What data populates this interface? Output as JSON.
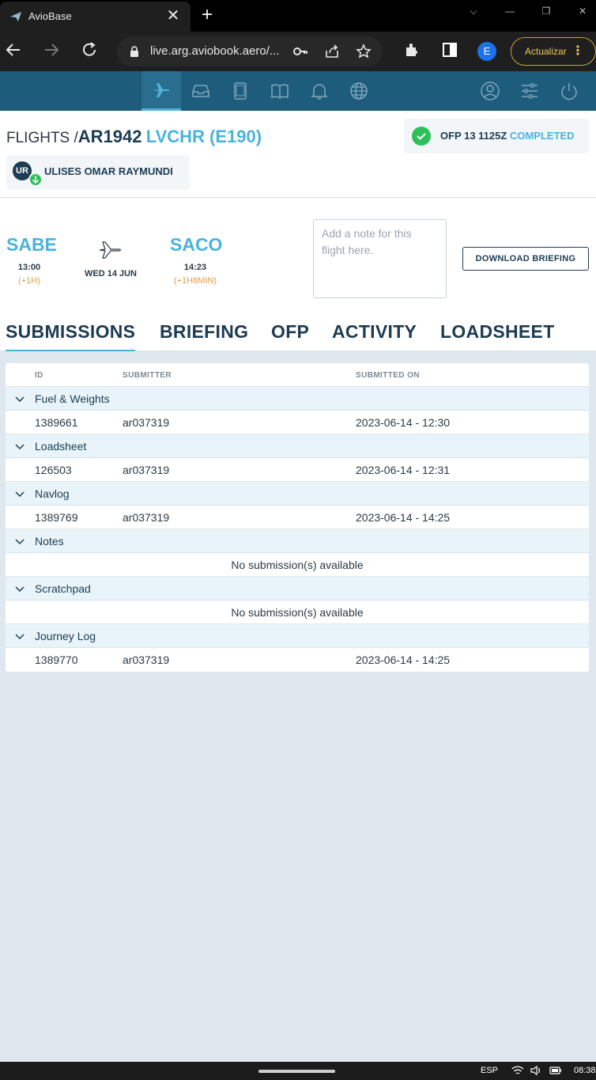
{
  "browser": {
    "tab_title": "AvioBase",
    "url": "live.arg.aviobook.aero/...",
    "profile_initial": "E",
    "update_label": "Actualizar"
  },
  "header": {
    "crumb_prefix": "FLIGHTS /",
    "flight_number": "AR1942",
    "aircraft": "LVCHR (E190)",
    "ofp_label": "OFP 13 1125Z",
    "ofp_status": "COMPLETED",
    "crew_initials": "UR",
    "crew_name": "ULISES OMAR RAYMUNDI"
  },
  "flight": {
    "origin": "SABE",
    "origin_time": "13:00",
    "origin_delay": "(+1H)",
    "date": "WED 14 JUN",
    "destination": "SACO",
    "destination_time": "14:23",
    "destination_delay": "(+1H8MIN)",
    "note_placeholder": "Add a note for this flight here.",
    "download_label": "DOWNLOAD BRIEFING"
  },
  "tabs": [
    "SUBMISSIONS",
    "BRIEFING",
    "OFP",
    "ACTIVITY",
    "LOADSHEET"
  ],
  "table": {
    "columns": [
      "ID",
      "SUBMITTER",
      "SUBMITTED ON"
    ],
    "empty_text": "No submission(s) available",
    "groups": [
      {
        "name": "Fuel & Weights",
        "rows": [
          [
            "1389661",
            "ar037319",
            "2023-06-14 - 12:30"
          ]
        ]
      },
      {
        "name": "Loadsheet",
        "rows": [
          [
            "126503",
            "ar037319",
            "2023-06-14 - 12:31"
          ]
        ]
      },
      {
        "name": "Navlog",
        "rows": [
          [
            "1389769",
            "ar037319",
            "2023-06-14 - 14:25"
          ]
        ]
      },
      {
        "name": "Notes",
        "rows": []
      },
      {
        "name": "Scratchpad",
        "rows": []
      },
      {
        "name": "Journey Log",
        "rows": [
          [
            "1389770",
            "ar037319",
            "2023-06-14 - 14:25"
          ]
        ]
      }
    ]
  },
  "taskbar": {
    "language": "ESP",
    "time": "08:38"
  },
  "colors": {
    "nav_bg": "#1d5c7a",
    "accent": "#4ab3dc",
    "dark_text": "#1d3c52",
    "success": "#2fbf5a",
    "warning": "#e89a4a"
  }
}
